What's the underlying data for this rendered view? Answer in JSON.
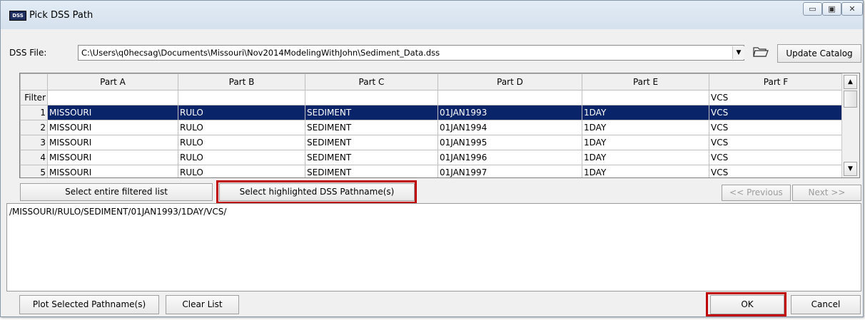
{
  "window": {
    "title": "Pick DSS Path",
    "icon": "DSS",
    "controls": {
      "minimize": "▭",
      "maximize": "▣",
      "close": "✕"
    }
  },
  "dss_file": {
    "label": "DSS File:",
    "path": "C:\\Users\\q0hecsag\\Documents\\Missouri\\Nov2014ModelingWithJohn\\Sediment_Data.dss",
    "update_catalog_label": "Update Catalog"
  },
  "grid": {
    "columns": [
      "Part A",
      "Part B",
      "Part C",
      "Part D",
      "Part E",
      "Part F"
    ],
    "filter_label": "Filter",
    "filter_values": [
      "",
      "",
      "",
      "",
      "",
      "VCS"
    ],
    "rows": [
      {
        "num": "1",
        "cells": [
          "MISSOURI",
          "RULO",
          "SEDIMENT",
          "01JAN1993",
          "1DAY",
          "VCS"
        ]
      },
      {
        "num": "2",
        "cells": [
          "MISSOURI",
          "RULO",
          "SEDIMENT",
          "01JAN1994",
          "1DAY",
          "VCS"
        ]
      },
      {
        "num": "3",
        "cells": [
          "MISSOURI",
          "RULO",
          "SEDIMENT",
          "01JAN1995",
          "1DAY",
          "VCS"
        ]
      },
      {
        "num": "4",
        "cells": [
          "MISSOURI",
          "RULO",
          "SEDIMENT",
          "01JAN1996",
          "1DAY",
          "VCS"
        ]
      },
      {
        "num": "5",
        "cells": [
          "MISSOURI",
          "RULO",
          "SEDIMENT",
          "01JAN1997",
          "1DAY",
          "VCS"
        ]
      }
    ],
    "selected_row": 1
  },
  "buttons": {
    "select_entire": "Select entire filtered list",
    "select_highlighted": "Select highlighted DSS Pathname(s)",
    "previous": "<< Previous",
    "next": "Next >>",
    "plot_selected": "Plot Selected Pathname(s)",
    "clear_list": "Clear List",
    "ok": "OK",
    "cancel": "Cancel"
  },
  "selected_paths": [
    "/MISSOURI/RULO/SEDIMENT/01JAN1993/1DAY/VCS/"
  ],
  "colors": {
    "selection": "#0a246a",
    "highlight_box": "#c00000"
  }
}
